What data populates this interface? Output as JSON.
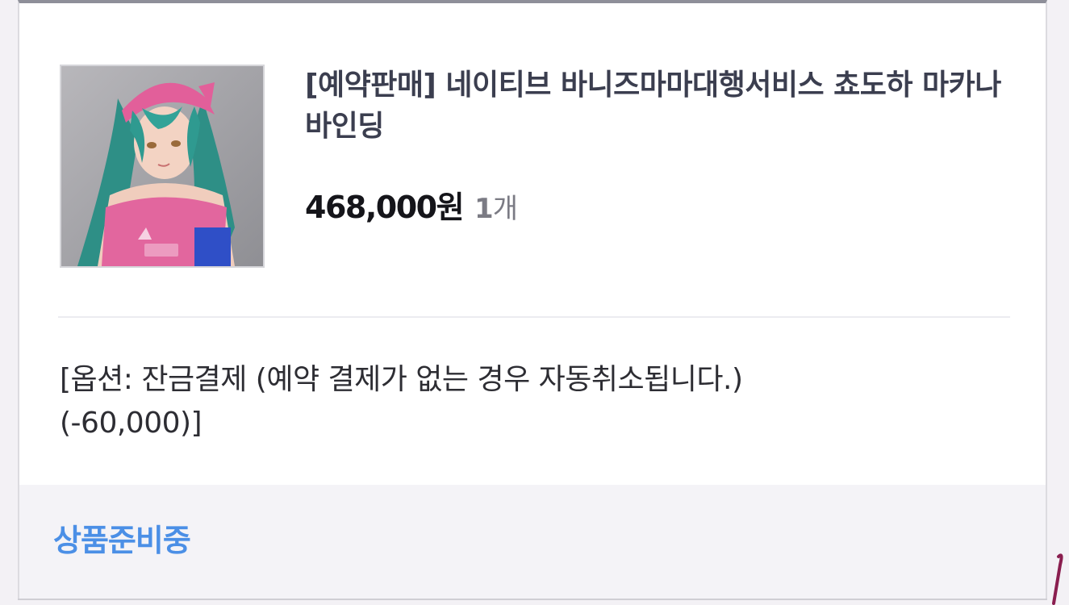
{
  "order_item": {
    "image_icon": "product-figure-thumbnail",
    "title": "[예약판매] 네이티브 바니즈마마대행서비스 쵸도하 마카나 바인딩",
    "price": "468,000원",
    "quantity_number": "1",
    "quantity_unit": "개",
    "option_line1": "[옵션: 잔금결제 (예약 결제가 없는 경우 자동취소됩니다.)",
    "option_line2": "(-60,000)]",
    "status": "상품준비중"
  },
  "colors": {
    "status_blue": "#4b8fe6",
    "title": "#3b3e4f",
    "price": "#15151a"
  }
}
